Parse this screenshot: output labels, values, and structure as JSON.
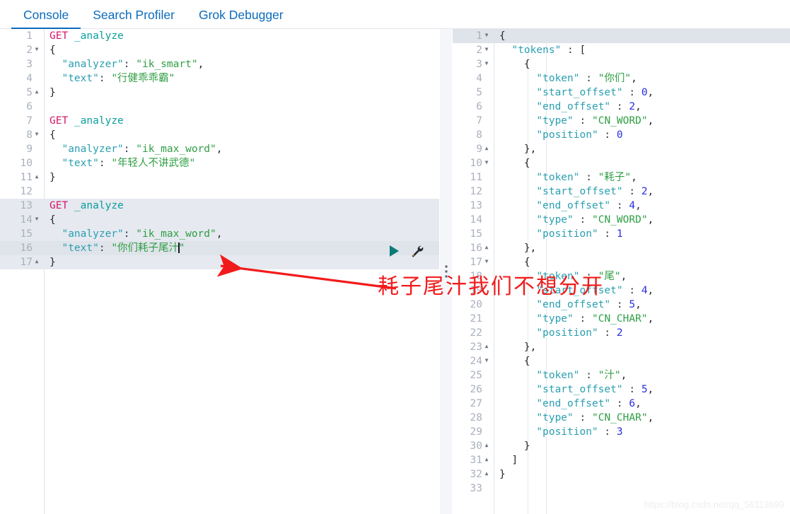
{
  "tabs": [
    {
      "label": "Console",
      "active": true
    },
    {
      "label": "Search Profiler",
      "active": false
    },
    {
      "label": "Grok Debugger",
      "active": false
    }
  ],
  "request_editor": {
    "name": "console-request-editor",
    "lines": [
      {
        "n": 1,
        "fold": "none",
        "tokens": [
          {
            "c": "t-method",
            "t": "GET"
          },
          {
            "c": "t-punc",
            "t": " "
          },
          {
            "c": "t-url",
            "t": "_analyze"
          }
        ]
      },
      {
        "n": 2,
        "fold": "open",
        "tokens": [
          {
            "c": "t-punc",
            "t": "{"
          }
        ]
      },
      {
        "n": 3,
        "fold": "none",
        "tokens": [
          {
            "c": "t-punc",
            "t": "  "
          },
          {
            "c": "t-key",
            "t": "\"analyzer\""
          },
          {
            "c": "t-colon",
            "t": ": "
          },
          {
            "c": "t-str",
            "t": "\"ik_smart\""
          },
          {
            "c": "t-punc",
            "t": ","
          }
        ]
      },
      {
        "n": 4,
        "fold": "none",
        "tokens": [
          {
            "c": "t-punc",
            "t": "  "
          },
          {
            "c": "t-key",
            "t": "\"text\""
          },
          {
            "c": "t-colon",
            "t": ": "
          },
          {
            "c": "t-strcn",
            "t": "\"行健乖乖霸\""
          }
        ]
      },
      {
        "n": 5,
        "fold": "close",
        "tokens": [
          {
            "c": "t-punc",
            "t": "}"
          }
        ]
      },
      {
        "n": 6,
        "fold": "none",
        "tokens": []
      },
      {
        "n": 7,
        "fold": "none",
        "tokens": [
          {
            "c": "t-method",
            "t": "GET"
          },
          {
            "c": "t-punc",
            "t": " "
          },
          {
            "c": "t-url",
            "t": "_analyze"
          }
        ]
      },
      {
        "n": 8,
        "fold": "open",
        "tokens": [
          {
            "c": "t-punc",
            "t": "{"
          }
        ]
      },
      {
        "n": 9,
        "fold": "none",
        "tokens": [
          {
            "c": "t-punc",
            "t": "  "
          },
          {
            "c": "t-key",
            "t": "\"analyzer\""
          },
          {
            "c": "t-colon",
            "t": ": "
          },
          {
            "c": "t-str",
            "t": "\"ik_max_word\""
          },
          {
            "c": "t-punc",
            "t": ","
          }
        ]
      },
      {
        "n": 10,
        "fold": "none",
        "tokens": [
          {
            "c": "t-punc",
            "t": "  "
          },
          {
            "c": "t-key",
            "t": "\"text\""
          },
          {
            "c": "t-colon",
            "t": ": "
          },
          {
            "c": "t-strcn",
            "t": "\"年轻人不讲武德\""
          }
        ]
      },
      {
        "n": 11,
        "fold": "close",
        "tokens": [
          {
            "c": "t-punc",
            "t": "}"
          }
        ]
      },
      {
        "n": 12,
        "fold": "none",
        "tokens": []
      },
      {
        "n": 13,
        "fold": "none",
        "hl": true,
        "tokens": [
          {
            "c": "t-method",
            "t": "GET"
          },
          {
            "c": "t-punc",
            "t": " "
          },
          {
            "c": "t-url",
            "t": "_analyze"
          }
        ]
      },
      {
        "n": 14,
        "fold": "open",
        "hl": true,
        "tokens": [
          {
            "c": "t-punc",
            "t": "{"
          }
        ]
      },
      {
        "n": 15,
        "fold": "none",
        "hl": true,
        "tokens": [
          {
            "c": "t-punc",
            "t": "  "
          },
          {
            "c": "t-key",
            "t": "\"analyzer\""
          },
          {
            "c": "t-colon",
            "t": ": "
          },
          {
            "c": "t-str",
            "t": "\"ik_max_word\""
          },
          {
            "c": "t-punc",
            "t": ","
          }
        ]
      },
      {
        "n": 16,
        "fold": "none",
        "cursorline": true,
        "caret_after": true,
        "tokens": [
          {
            "c": "t-punc",
            "t": "  "
          },
          {
            "c": "t-key",
            "t": "\"text\""
          },
          {
            "c": "t-colon",
            "t": ": "
          },
          {
            "c": "t-strcn",
            "t": "\"你们耗子尾汁"
          }
        ],
        "tail": [
          {
            "c": "t-strcn",
            "t": "\""
          }
        ]
      },
      {
        "n": 17,
        "fold": "close",
        "hl": true,
        "tokens": [
          {
            "c": "t-punc",
            "t": "}"
          }
        ]
      }
    ]
  },
  "response_editor": {
    "name": "console-response-viewer",
    "lines": [
      {
        "n": 1,
        "fold": "open",
        "cursorline": true,
        "tokens": [
          {
            "c": "t-punc",
            "t": "{"
          }
        ]
      },
      {
        "n": 2,
        "fold": "open",
        "tokens": [
          {
            "c": "t-punc",
            "t": "  "
          },
          {
            "c": "t-key",
            "t": "\"tokens\""
          },
          {
            "c": "t-colon",
            "t": " : "
          },
          {
            "c": "t-punc",
            "t": "["
          }
        ]
      },
      {
        "n": 3,
        "fold": "open",
        "tokens": [
          {
            "c": "t-punc",
            "t": "    {"
          }
        ]
      },
      {
        "n": 4,
        "fold": "none",
        "tokens": [
          {
            "c": "t-punc",
            "t": "      "
          },
          {
            "c": "t-key",
            "t": "\"token\""
          },
          {
            "c": "t-colon",
            "t": " : "
          },
          {
            "c": "t-strcn",
            "t": "\"你们\""
          },
          {
            "c": "t-punc",
            "t": ","
          }
        ]
      },
      {
        "n": 5,
        "fold": "none",
        "tokens": [
          {
            "c": "t-punc",
            "t": "      "
          },
          {
            "c": "t-key",
            "t": "\"start_offset\""
          },
          {
            "c": "t-colon",
            "t": " : "
          },
          {
            "c": "t-num",
            "t": "0"
          },
          {
            "c": "t-punc",
            "t": ","
          }
        ]
      },
      {
        "n": 6,
        "fold": "none",
        "tokens": [
          {
            "c": "t-punc",
            "t": "      "
          },
          {
            "c": "t-key",
            "t": "\"end_offset\""
          },
          {
            "c": "t-colon",
            "t": " : "
          },
          {
            "c": "t-num",
            "t": "2"
          },
          {
            "c": "t-punc",
            "t": ","
          }
        ]
      },
      {
        "n": 7,
        "fold": "none",
        "tokens": [
          {
            "c": "t-punc",
            "t": "      "
          },
          {
            "c": "t-key",
            "t": "\"type\""
          },
          {
            "c": "t-colon",
            "t": " : "
          },
          {
            "c": "t-str",
            "t": "\"CN_WORD\""
          },
          {
            "c": "t-punc",
            "t": ","
          }
        ]
      },
      {
        "n": 8,
        "fold": "none",
        "tokens": [
          {
            "c": "t-punc",
            "t": "      "
          },
          {
            "c": "t-key",
            "t": "\"position\""
          },
          {
            "c": "t-colon",
            "t": " : "
          },
          {
            "c": "t-num",
            "t": "0"
          }
        ]
      },
      {
        "n": 9,
        "fold": "close",
        "tokens": [
          {
            "c": "t-punc",
            "t": "    },"
          }
        ]
      },
      {
        "n": 10,
        "fold": "open",
        "tokens": [
          {
            "c": "t-punc",
            "t": "    {"
          }
        ]
      },
      {
        "n": 11,
        "fold": "none",
        "tokens": [
          {
            "c": "t-punc",
            "t": "      "
          },
          {
            "c": "t-key",
            "t": "\"token\""
          },
          {
            "c": "t-colon",
            "t": " : "
          },
          {
            "c": "t-strcn",
            "t": "\"耗子\""
          },
          {
            "c": "t-punc",
            "t": ","
          }
        ]
      },
      {
        "n": 12,
        "fold": "none",
        "tokens": [
          {
            "c": "t-punc",
            "t": "      "
          },
          {
            "c": "t-key",
            "t": "\"start_offset\""
          },
          {
            "c": "t-colon",
            "t": " : "
          },
          {
            "c": "t-num",
            "t": "2"
          },
          {
            "c": "t-punc",
            "t": ","
          }
        ]
      },
      {
        "n": 13,
        "fold": "none",
        "tokens": [
          {
            "c": "t-punc",
            "t": "      "
          },
          {
            "c": "t-key",
            "t": "\"end_offset\""
          },
          {
            "c": "t-colon",
            "t": " : "
          },
          {
            "c": "t-num",
            "t": "4"
          },
          {
            "c": "t-punc",
            "t": ","
          }
        ]
      },
      {
        "n": 14,
        "fold": "none",
        "tokens": [
          {
            "c": "t-punc",
            "t": "      "
          },
          {
            "c": "t-key",
            "t": "\"type\""
          },
          {
            "c": "t-colon",
            "t": " : "
          },
          {
            "c": "t-str",
            "t": "\"CN_WORD\""
          },
          {
            "c": "t-punc",
            "t": ","
          }
        ]
      },
      {
        "n": 15,
        "fold": "none",
        "tokens": [
          {
            "c": "t-punc",
            "t": "      "
          },
          {
            "c": "t-key",
            "t": "\"position\""
          },
          {
            "c": "t-colon",
            "t": " : "
          },
          {
            "c": "t-num",
            "t": "1"
          }
        ]
      },
      {
        "n": 16,
        "fold": "close",
        "tokens": [
          {
            "c": "t-punc",
            "t": "    },"
          }
        ]
      },
      {
        "n": 17,
        "fold": "open",
        "tokens": [
          {
            "c": "t-punc",
            "t": "    {"
          }
        ]
      },
      {
        "n": 18,
        "fold": "none",
        "tokens": [
          {
            "c": "t-punc",
            "t": "      "
          },
          {
            "c": "t-key",
            "t": "\"token\""
          },
          {
            "c": "t-colon",
            "t": " : "
          },
          {
            "c": "t-strcn",
            "t": "\"尾\""
          },
          {
            "c": "t-punc",
            "t": ","
          }
        ]
      },
      {
        "n": 19,
        "fold": "none",
        "tokens": [
          {
            "c": "t-punc",
            "t": "      "
          },
          {
            "c": "t-key",
            "t": "\"start_offset\""
          },
          {
            "c": "t-colon",
            "t": " : "
          },
          {
            "c": "t-num",
            "t": "4"
          },
          {
            "c": "t-punc",
            "t": ","
          }
        ]
      },
      {
        "n": 20,
        "fold": "none",
        "tokens": [
          {
            "c": "t-punc",
            "t": "      "
          },
          {
            "c": "t-key",
            "t": "\"end_offset\""
          },
          {
            "c": "t-colon",
            "t": " : "
          },
          {
            "c": "t-num",
            "t": "5"
          },
          {
            "c": "t-punc",
            "t": ","
          }
        ]
      },
      {
        "n": 21,
        "fold": "none",
        "tokens": [
          {
            "c": "t-punc",
            "t": "      "
          },
          {
            "c": "t-key",
            "t": "\"type\""
          },
          {
            "c": "t-colon",
            "t": " : "
          },
          {
            "c": "t-str",
            "t": "\"CN_CHAR\""
          },
          {
            "c": "t-punc",
            "t": ","
          }
        ]
      },
      {
        "n": 22,
        "fold": "none",
        "tokens": [
          {
            "c": "t-punc",
            "t": "      "
          },
          {
            "c": "t-key",
            "t": "\"position\""
          },
          {
            "c": "t-colon",
            "t": " : "
          },
          {
            "c": "t-num",
            "t": "2"
          }
        ]
      },
      {
        "n": 23,
        "fold": "close",
        "tokens": [
          {
            "c": "t-punc",
            "t": "    },"
          }
        ]
      },
      {
        "n": 24,
        "fold": "open",
        "tokens": [
          {
            "c": "t-punc",
            "t": "    {"
          }
        ]
      },
      {
        "n": 25,
        "fold": "none",
        "tokens": [
          {
            "c": "t-punc",
            "t": "      "
          },
          {
            "c": "t-key",
            "t": "\"token\""
          },
          {
            "c": "t-colon",
            "t": " : "
          },
          {
            "c": "t-strcn",
            "t": "\"汁\""
          },
          {
            "c": "t-punc",
            "t": ","
          }
        ]
      },
      {
        "n": 26,
        "fold": "none",
        "tokens": [
          {
            "c": "t-punc",
            "t": "      "
          },
          {
            "c": "t-key",
            "t": "\"start_offset\""
          },
          {
            "c": "t-colon",
            "t": " : "
          },
          {
            "c": "t-num",
            "t": "5"
          },
          {
            "c": "t-punc",
            "t": ","
          }
        ]
      },
      {
        "n": 27,
        "fold": "none",
        "tokens": [
          {
            "c": "t-punc",
            "t": "      "
          },
          {
            "c": "t-key",
            "t": "\"end_offset\""
          },
          {
            "c": "t-colon",
            "t": " : "
          },
          {
            "c": "t-num",
            "t": "6"
          },
          {
            "c": "t-punc",
            "t": ","
          }
        ]
      },
      {
        "n": 28,
        "fold": "none",
        "tokens": [
          {
            "c": "t-punc",
            "t": "      "
          },
          {
            "c": "t-key",
            "t": "\"type\""
          },
          {
            "c": "t-colon",
            "t": " : "
          },
          {
            "c": "t-str",
            "t": "\"CN_CHAR\""
          },
          {
            "c": "t-punc",
            "t": ","
          }
        ]
      },
      {
        "n": 29,
        "fold": "none",
        "tokens": [
          {
            "c": "t-punc",
            "t": "      "
          },
          {
            "c": "t-key",
            "t": "\"position\""
          },
          {
            "c": "t-colon",
            "t": " : "
          },
          {
            "c": "t-num",
            "t": "3"
          }
        ]
      },
      {
        "n": 30,
        "fold": "close",
        "tokens": [
          {
            "c": "t-punc",
            "t": "    }"
          }
        ]
      },
      {
        "n": 31,
        "fold": "close",
        "tokens": [
          {
            "c": "t-punc",
            "t": "  ]"
          }
        ]
      },
      {
        "n": 32,
        "fold": "close",
        "tokens": [
          {
            "c": "t-punc",
            "t": "}"
          }
        ]
      },
      {
        "n": 33,
        "fold": "none",
        "tokens": []
      }
    ]
  },
  "toolbar": {
    "run_label": "play-button",
    "wrench_label": "wrench-button"
  },
  "annotation": {
    "text": "耗子尾汁我们不想分开",
    "color": "#f21b1b"
  },
  "watermark": "https://blog.csdn.net/qq_56113699",
  "colors": {
    "accent": "#0b6bbb",
    "method": "#d6186a",
    "url": "#0a9e9e",
    "key": "#2a9fb0",
    "string": "#2f9e44",
    "number": "#2a2ee0",
    "run": "#0a7b79",
    "highlight": "#e6e9f0"
  }
}
